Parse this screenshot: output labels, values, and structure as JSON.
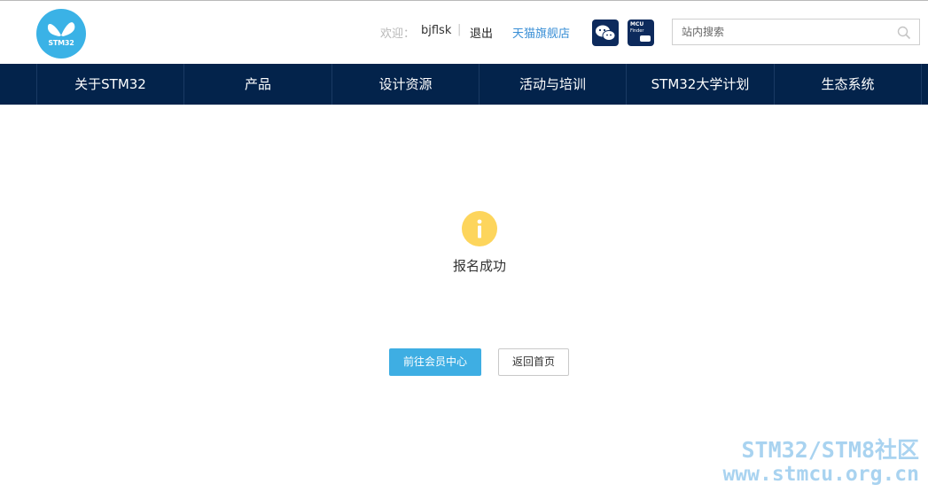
{
  "header": {
    "logo_text": "STM32",
    "welcome_label": "欢迎：",
    "username": "bjflsk",
    "separator": "|",
    "logout_label": "退出",
    "tmall_label": "天猫旗舰店",
    "mcu_finder": {
      "line1": "MCU",
      "line2": "Finder"
    },
    "search": {
      "placeholder": "站内搜索",
      "value": ""
    }
  },
  "nav": {
    "items": [
      "关于STM32",
      "产品",
      "设计资源",
      "活动与培训",
      "STM32大学计划",
      "生态系统"
    ]
  },
  "main": {
    "message": "报名成功",
    "primary_button": "前往会员中心",
    "secondary_button": "返回首页"
  },
  "watermark": {
    "line1": "STM32/STM8社区",
    "line2": "www.stmcu.org.cn"
  },
  "colors": {
    "nav_bg": "#03234b",
    "logo_bg": "#3ab2e6",
    "info_icon": "#fdd55c",
    "primary_button": "#3eaee3",
    "link": "#3a8fd6"
  }
}
